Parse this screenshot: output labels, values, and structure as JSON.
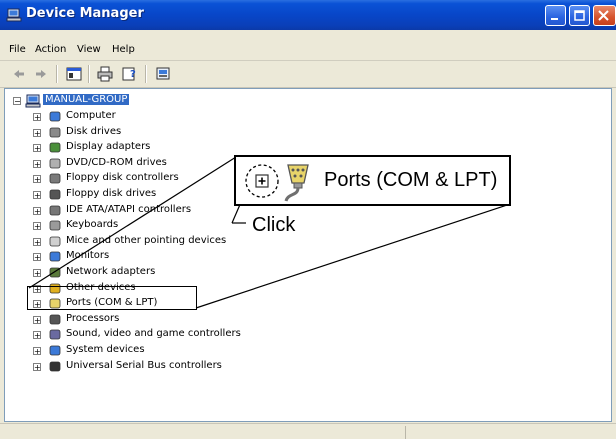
{
  "window": {
    "title": "Device Manager",
    "icon": "device-manager-icon"
  },
  "menu": [
    "File",
    "Action",
    "View",
    "Help"
  ],
  "toolbar": {
    "buttons": [
      "back-icon",
      "forward-icon",
      "show-hide-console-tree-icon",
      "print-icon",
      "help-icon",
      "properties-icon"
    ]
  },
  "tree": {
    "root": "MANUAL-GROUP",
    "items": [
      {
        "label": "Computer",
        "icon": "computer-icon"
      },
      {
        "label": "Disk drives",
        "icon": "disk-drive-icon"
      },
      {
        "label": "Display adapters",
        "icon": "display-adapter-icon"
      },
      {
        "label": "DVD/CD-ROM drives",
        "icon": "dvd-drive-icon"
      },
      {
        "label": "Floppy disk controllers",
        "icon": "floppy-controller-icon"
      },
      {
        "label": "Floppy disk drives",
        "icon": "floppy-drive-icon"
      },
      {
        "label": "IDE ATA/ATAPI controllers",
        "icon": "ide-controller-icon"
      },
      {
        "label": "Keyboards",
        "icon": "keyboard-icon"
      },
      {
        "label": "Mice and other pointing devices",
        "icon": "mouse-icon"
      },
      {
        "label": "Monitors",
        "icon": "monitor-icon"
      },
      {
        "label": "Network adapters",
        "icon": "network-adapter-icon"
      },
      {
        "label": "Other devices",
        "icon": "other-devices-icon"
      },
      {
        "label": "Ports (COM & LPT)",
        "icon": "port-icon"
      },
      {
        "label": "Processors",
        "icon": "processor-icon"
      },
      {
        "label": "Sound, video and game controllers",
        "icon": "sound-icon"
      },
      {
        "label": "System devices",
        "icon": "system-device-icon"
      },
      {
        "label": "Universal Serial Bus controllers",
        "icon": "usb-icon"
      }
    ]
  },
  "callout": {
    "label": "Ports (COM & LPT)",
    "click": "Click"
  }
}
